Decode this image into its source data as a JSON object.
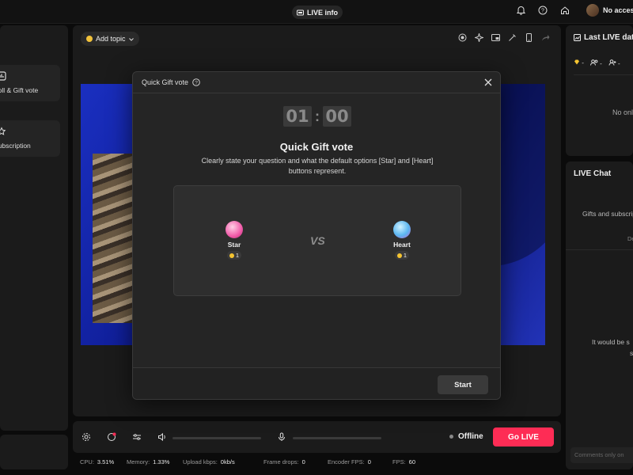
{
  "topbar": {
    "live_info_label": "LIVE info",
    "account_label": "No access"
  },
  "left": {
    "items": [
      {
        "label": "Poll & Gift vote",
        "icon": "poll-icon"
      },
      {
        "label": "Subscription",
        "icon": "subscription-icon"
      }
    ]
  },
  "center": {
    "add_topic_label": "Add topic"
  },
  "modal": {
    "title": "Quick Gift vote",
    "timer_minutes": "01",
    "timer_seconds": "00",
    "heading": "Quick Gift vote",
    "description": "Clearly state your question and what the default options [Star] and [Heart] buttons represent.",
    "vs_label": "VS",
    "options": [
      {
        "name": "Star",
        "coins": "1"
      },
      {
        "name": "Heart",
        "coins": "1"
      }
    ],
    "start_label": "Start"
  },
  "controls": {
    "status_label": "Offline",
    "go_live_label": "Go LIVE"
  },
  "stats": [
    {
      "label": "CPU:",
      "value": "3.51%"
    },
    {
      "label": "Memory:",
      "value": "1.33%"
    },
    {
      "label": "Upload kbps:",
      "value": "0kb/s"
    },
    {
      "label": "Frame drops:",
      "value": "0"
    },
    {
      "label": "Encoder FPS:",
      "value": "0"
    },
    {
      "label": "FPS:",
      "value": "60"
    }
  ],
  "right": {
    "last_live_title": "Last LIVE data",
    "stat_values": [
      "-",
      "-",
      "-"
    ],
    "no_online_text": "No online",
    "chat_title": "LIVE Chat",
    "gifts_text": "Gifts and subscriptions",
    "sub_text": "De",
    "would_text": "It would be s",
    "would_text2": "s",
    "input_placeholder": "Comments only on"
  },
  "colors": {
    "accent": "#fe2c55",
    "coin": "#f5c431"
  }
}
